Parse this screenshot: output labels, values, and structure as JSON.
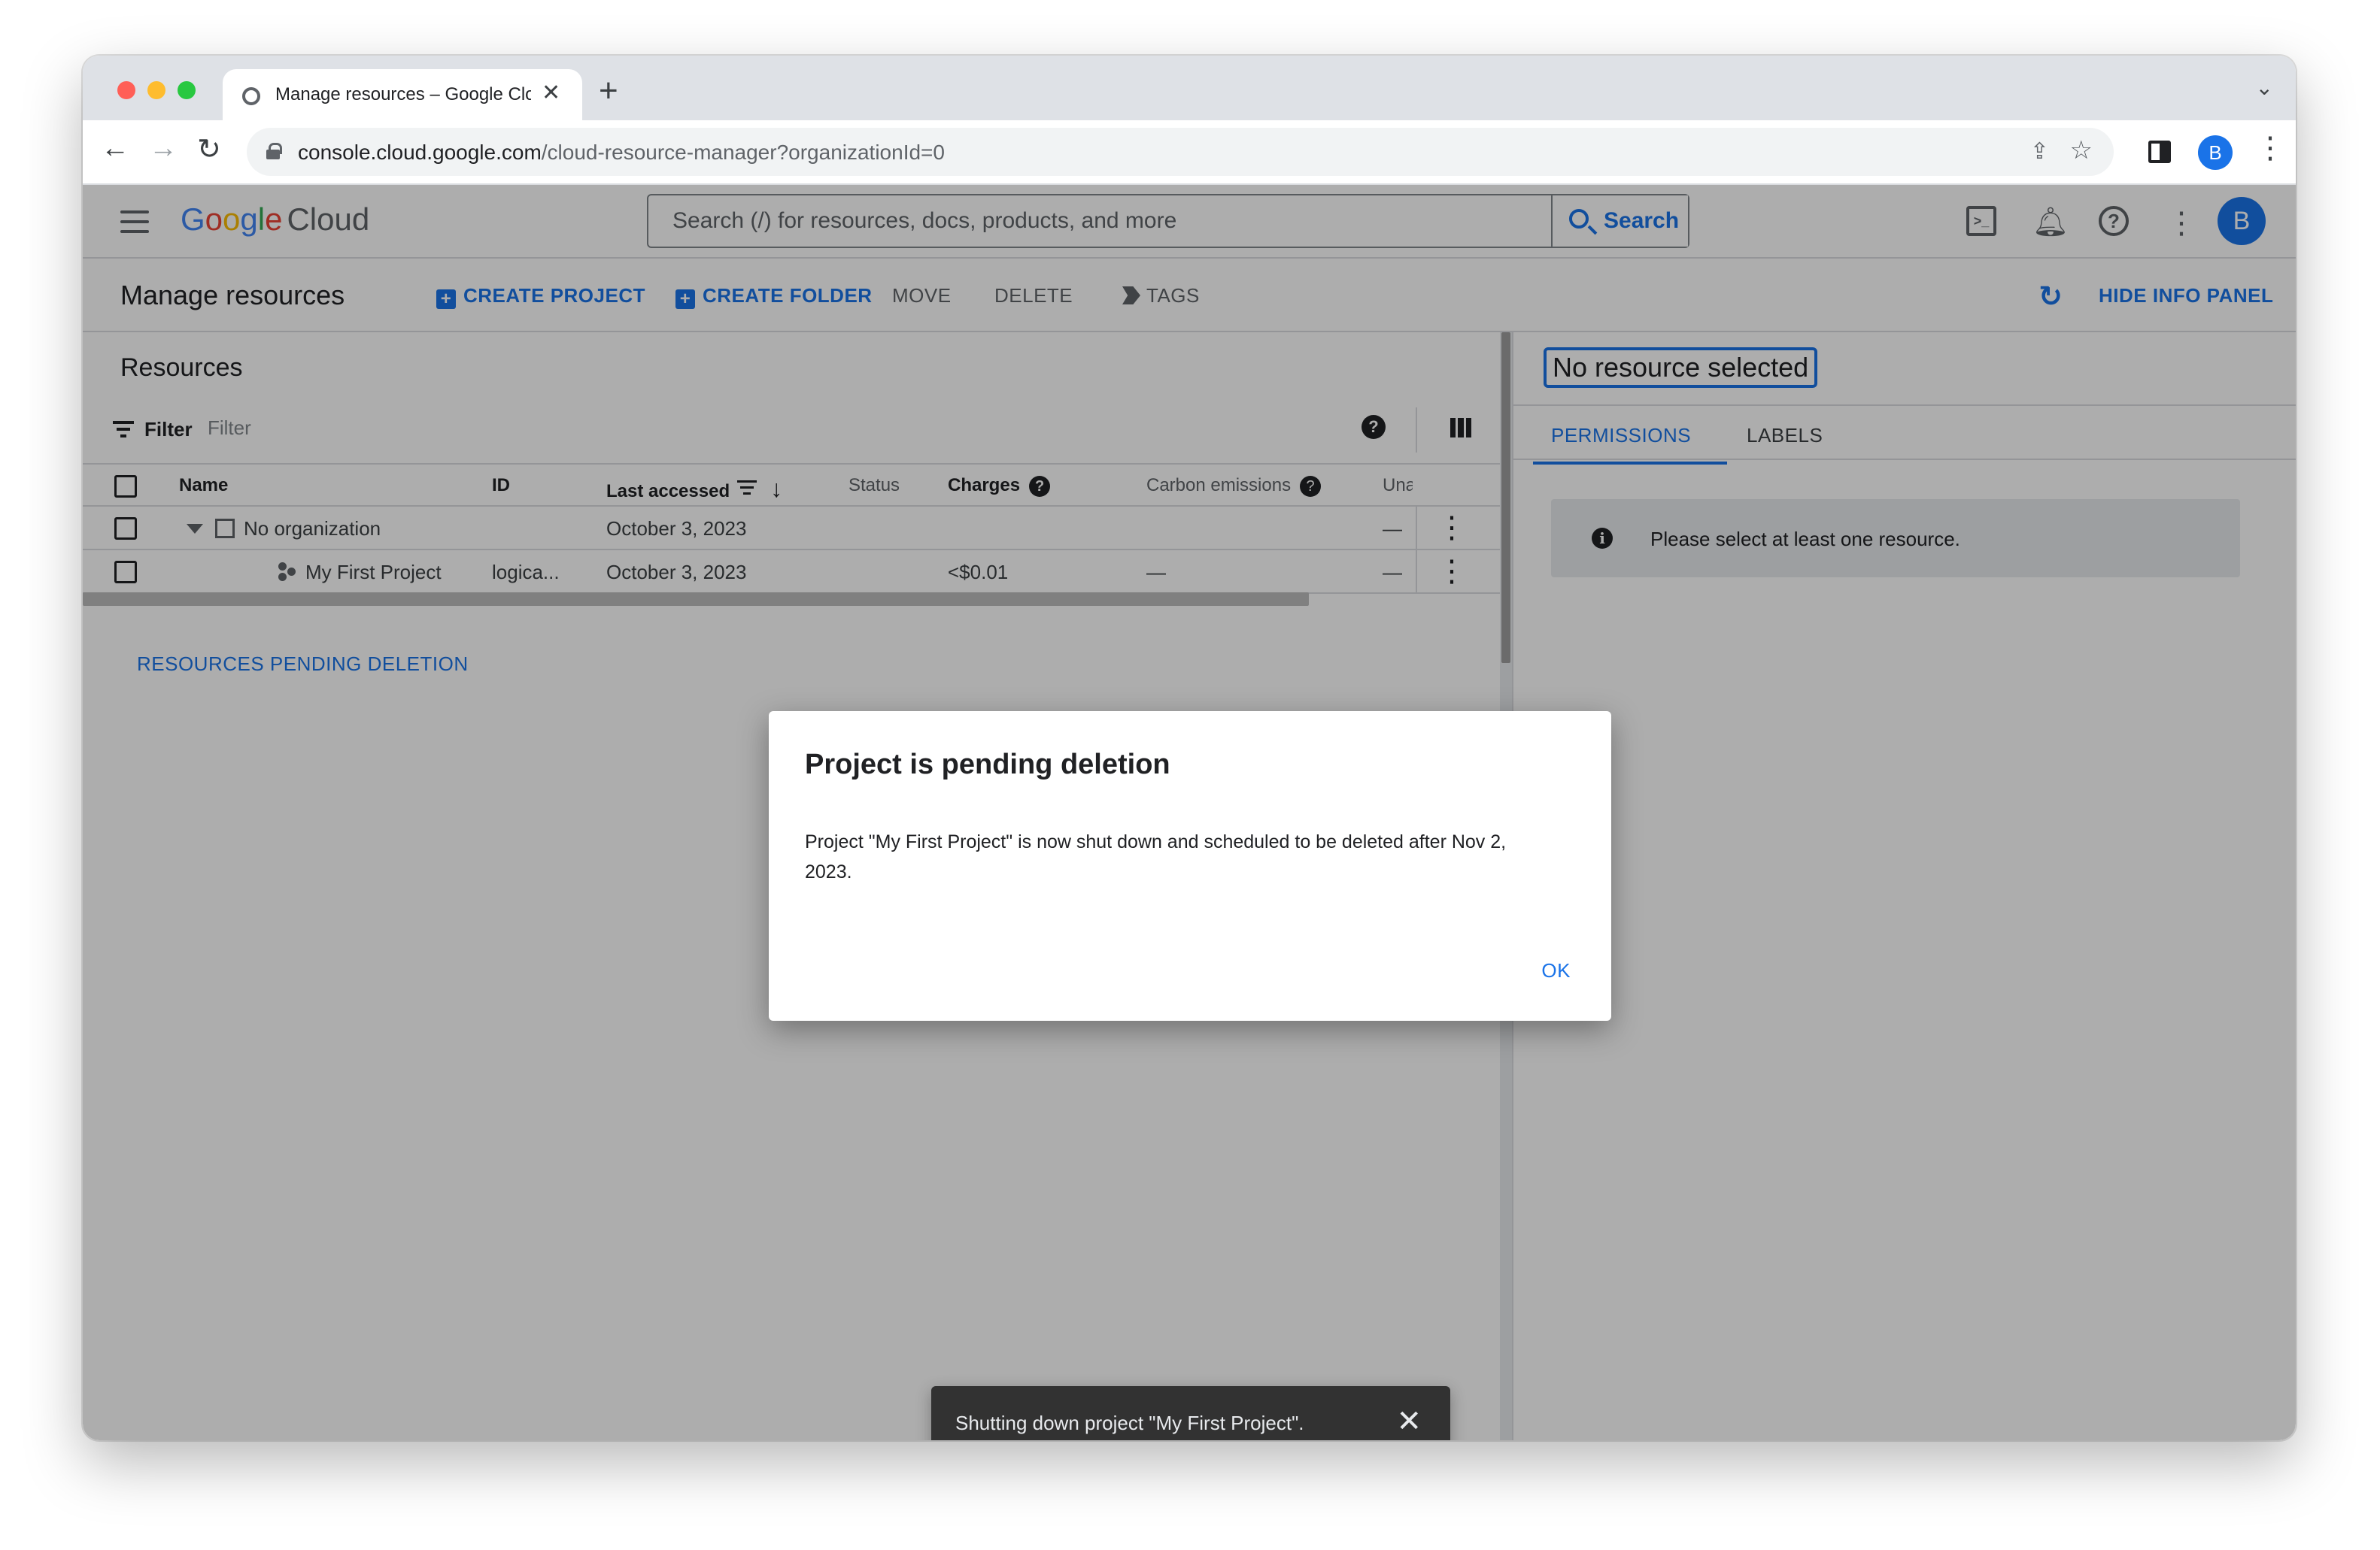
{
  "browser": {
    "tab_title": "Manage resources – Google Cloud",
    "url_host": "console.cloud.google.com",
    "url_path": "/cloud-resource-manager?organizationId=0",
    "profile_initial": "B"
  },
  "header": {
    "logo_google": [
      "G",
      "o",
      "o",
      "g",
      "l",
      "e"
    ],
    "logo_cloud": "Cloud",
    "search_placeholder": "Search (/) for resources, docs, products, and more",
    "search_button": "Search",
    "avatar_initial": "B"
  },
  "actionbar": {
    "title": "Manage resources",
    "create_project": "CREATE PROJECT",
    "create_folder": "CREATE FOLDER",
    "move": "MOVE",
    "delete": "DELETE",
    "tags": "TAGS",
    "hide_info_panel": "HIDE INFO PANEL"
  },
  "resources": {
    "title": "Resources",
    "filter_label": "Filter",
    "filter_placeholder": "Filter",
    "columns": {
      "name": "Name",
      "id": "ID",
      "last_accessed": "Last accessed",
      "status": "Status",
      "charges": "Charges",
      "carbon": "Carbon emissions",
      "unat": "Unat"
    },
    "rows": [
      {
        "name": "No organization",
        "id": "",
        "last_accessed": "October 3, 2023",
        "status": "",
        "charges": "",
        "carbon": "",
        "unat": "—"
      },
      {
        "name": "My First Project",
        "id": "logica...",
        "last_accessed": "October 3, 2023",
        "status": "",
        "charges": "<$0.01",
        "carbon": "—",
        "unat": "—"
      }
    ],
    "pending_link": "RESOURCES PENDING DELETION"
  },
  "info_panel": {
    "title": "No resource selected",
    "tab_permissions": "PERMISSIONS",
    "tab_labels": "LABELS",
    "message": "Please select at least one resource."
  },
  "dialog": {
    "title": "Project is pending deletion",
    "body": "Project \"My First Project\" is now shut down and scheduled to be deleted after Nov 2, 2023.",
    "ok": "OK"
  },
  "snackbar": {
    "message": "Shutting down project \"My First Project\"."
  },
  "colors": {
    "accent": "#1a73e8",
    "scrim": "rgba(0,0,0,0.32)"
  }
}
